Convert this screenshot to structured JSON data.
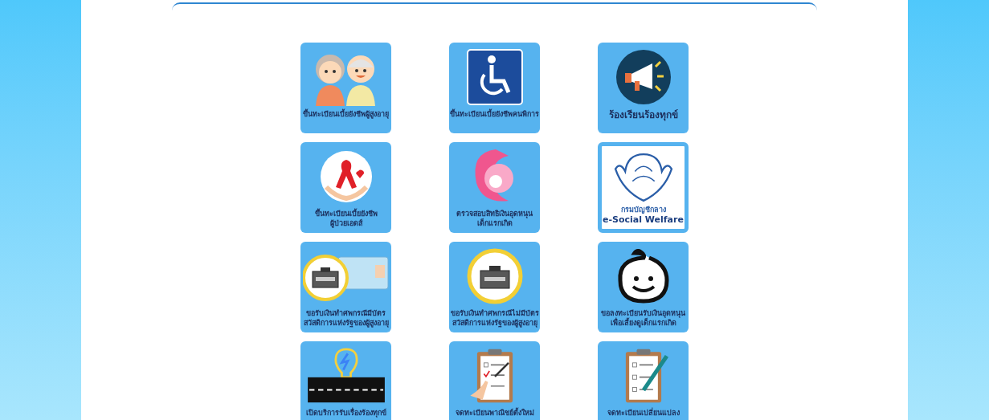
{
  "tiles": [
    {
      "kind": "elderly",
      "label": [
        "ขึ้นทะเบียนเบี้ยยังชีพผู้สูงอายุ"
      ]
    },
    {
      "kind": "wheelchair",
      "label": [
        "ขึ้นทะเบียนเบี้ยยังชีพคนพิการ"
      ]
    },
    {
      "kind": "megaphone",
      "label": [
        "ร้องเรียนร้องทุกข์"
      ]
    },
    {
      "kind": "ribbon",
      "label": [
        "ขึ้นทะเบียนเบี้ยยังชีพ",
        "ผู้ป่วยเอดส์"
      ]
    },
    {
      "kind": "mother",
      "label": [
        "ตรวจสอบสิทธิเงินอุดหนุน",
        "เด็กแรกเกิด"
      ]
    },
    {
      "kind": "emblem",
      "emblem_text": "กรมบัญชีกลาง",
      "label": [
        "e-Social Welfare"
      ]
    },
    {
      "kind": "coffin-card",
      "label": [
        "ขอรับเงินทำศพกรณีมีบัตร",
        "สวัสดิการแห่งรัฐของผู้สูงอายุ"
      ]
    },
    {
      "kind": "coffin",
      "label": [
        "ขอรับเงินทำศพกรณีไม่มีบัตร",
        "สวัสดิการแห่งรัฐของผู้สูงอายุ"
      ]
    },
    {
      "kind": "baby",
      "label": [
        "ขอลงทะเบียนรับเงินอุดหนุน",
        "เพื่อเลี้ยงดูเด็กแรกเกิด"
      ]
    },
    {
      "kind": "bulb-road",
      "label": [
        "เปิดบริการรับเรื่องร้องทุกข์"
      ]
    },
    {
      "kind": "clipboard-hand",
      "label": [
        "จดทะเบียนพาณิชย์ตั้งใหม่"
      ]
    },
    {
      "kind": "clipboard-pen",
      "label": [
        "จดทะเบียนเปลี่ยนแปลง"
      ]
    }
  ]
}
